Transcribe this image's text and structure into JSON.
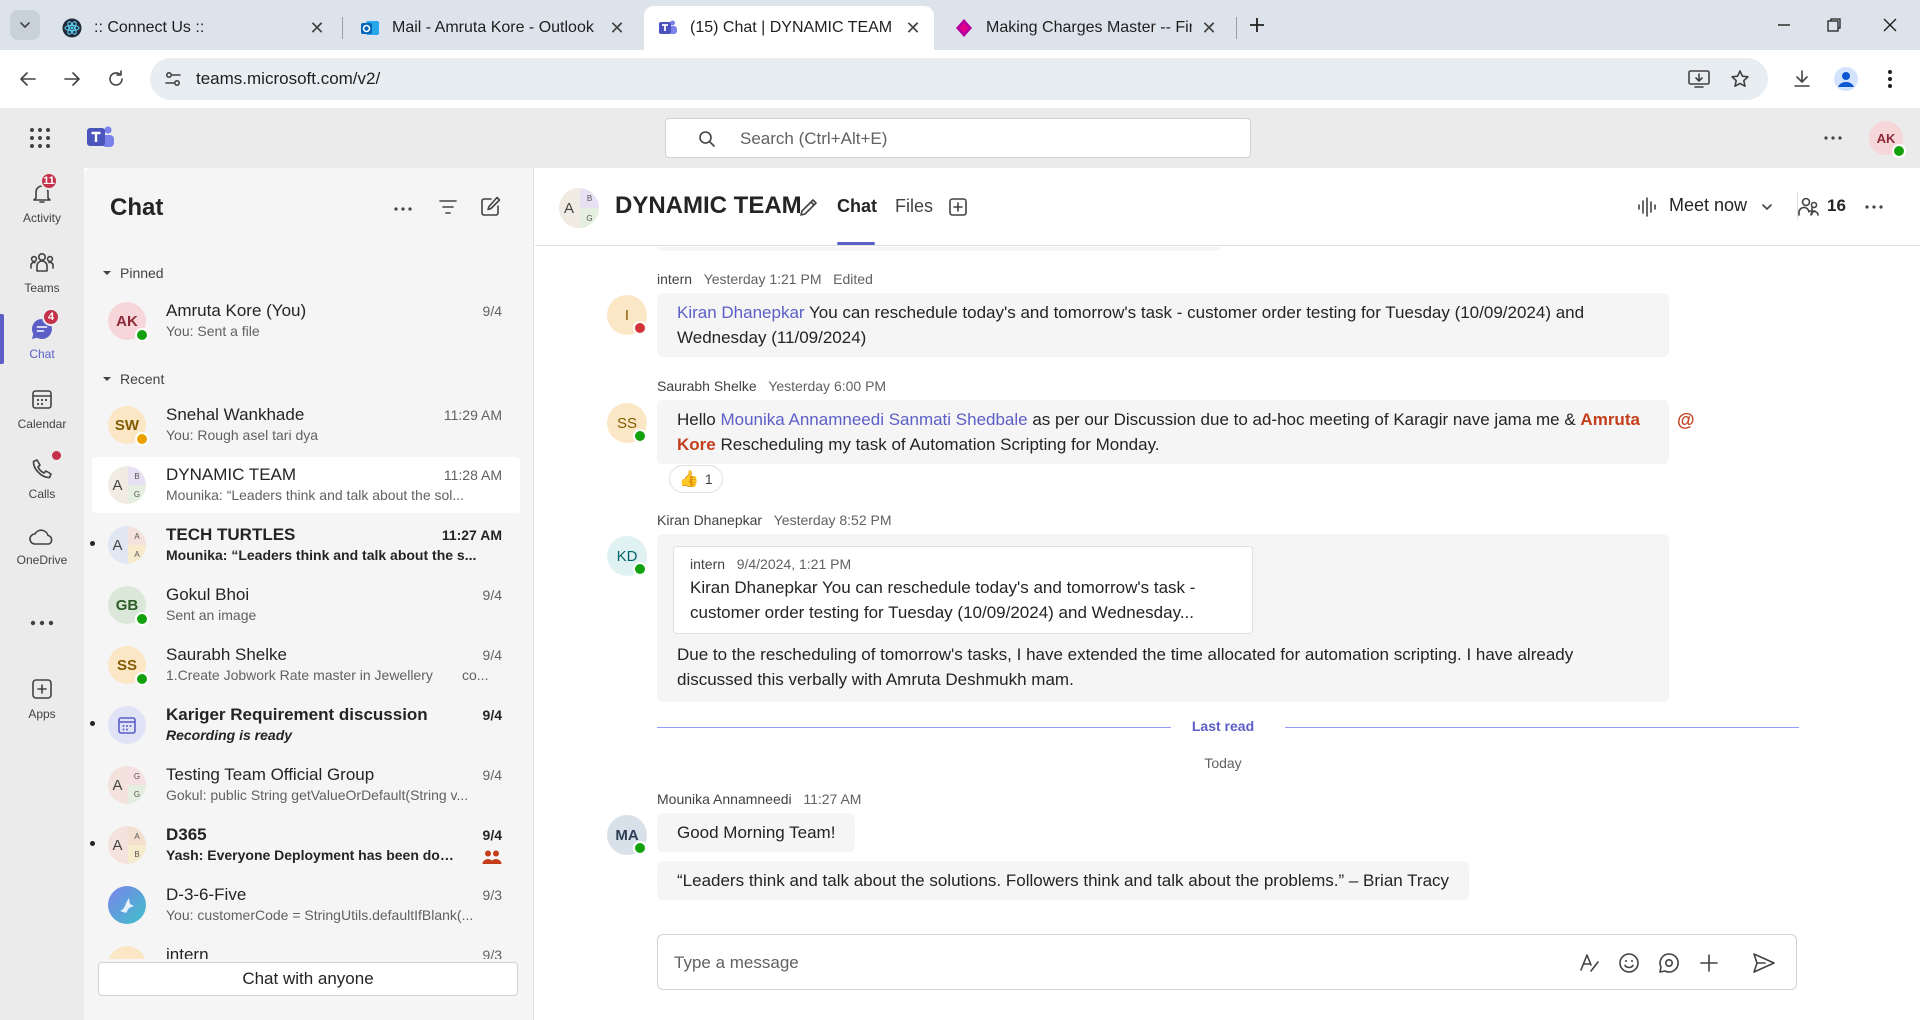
{
  "browser": {
    "tabs": [
      {
        "title": ":: Connect Us ::",
        "active": false
      },
      {
        "title": "Mail - Amruta Kore - Outlook",
        "active": false
      },
      {
        "title": "(15) Chat | DYNAMIC TEAM | Mi",
        "active": true
      },
      {
        "title": "Making Charges Master -- Finar",
        "active": false
      }
    ],
    "url": "teams.microsoft.com/v2/"
  },
  "header": {
    "search_placeholder": "Search (Ctrl+Alt+E)",
    "user_initials": "AK"
  },
  "rail": {
    "items": [
      {
        "label": "Activity",
        "icon": "bell-icon",
        "badge": "11"
      },
      {
        "label": "Teams",
        "icon": "teams-people-icon",
        "badge": ""
      },
      {
        "label": "Chat",
        "icon": "chat-bubble-icon",
        "badge": "4"
      },
      {
        "label": "Calendar",
        "icon": "calendar-icon",
        "badge": ""
      },
      {
        "label": "Calls",
        "icon": "phone-icon",
        "badge": ""
      },
      {
        "label": "OneDrive",
        "icon": "cloud-icon",
        "badge": ""
      },
      {
        "label": "Apps",
        "icon": "apps-add-icon",
        "badge": ""
      }
    ]
  },
  "chat_list": {
    "title": "Chat",
    "pinned_label": "Pinned",
    "recent_label": "Recent",
    "pinned": [
      {
        "name": "Amruta Kore (You)",
        "preview": "You: Sent a file",
        "time": "9/4",
        "initials": "AK"
      }
    ],
    "recent": [
      {
        "name": "Snehal Wankhade",
        "preview": "You: Rough asel tari dya",
        "time": "11:29 AM",
        "initials": "SW"
      },
      {
        "name": "DYNAMIC TEAM",
        "preview": "Mounika: “Leaders think and talk about the sol...",
        "time": "11:28 AM",
        "initials": "A",
        "g1": "B",
        "g2": "G"
      },
      {
        "name": "TECH TURTLES",
        "preview": "Mounika: “Leaders think and talk about the s...",
        "time": "11:27 AM",
        "initials": "A",
        "g1": "A",
        "g2": "A"
      },
      {
        "name": "Gokul Bhoi",
        "preview": "Sent an image",
        "time": "9/4",
        "initials": "GB"
      },
      {
        "name": "Saurabh Shelke",
        "preview": "1.Create Jobwork Rate master in Jewellery",
        "preview_tail": "co...",
        "time": "9/4",
        "initials": "SS"
      },
      {
        "name": "Kariger Requirement discussion",
        "preview": "Recording is ready",
        "time": "9/4",
        "initials": ""
      },
      {
        "name": "Testing Team Official Group",
        "preview": "Gokul: public String getValueOrDefault(String v...",
        "time": "9/4",
        "initials": "A",
        "g1": "G",
        "g2": "G"
      },
      {
        "name": "D365",
        "preview": "Yash: Everyone Deployment has been done",
        "time": "9/4",
        "initials": "A",
        "g1": "A",
        "g2": "B"
      },
      {
        "name": "D-3-6-Five",
        "preview": "You: customerCode = StringUtils.defaultIfBlank(...",
        "time": "9/3",
        "initials": ""
      },
      {
        "name": "intern",
        "preview": "",
        "time": "9/3",
        "initials": ""
      }
    ],
    "chat_with_anyone": "Chat with anyone"
  },
  "conversation": {
    "title": "DYNAMIC TEAM",
    "avatar": {
      "initials": "A",
      "g1": "B",
      "g2": "G"
    },
    "tabs": [
      {
        "label": "Chat",
        "active": true
      },
      {
        "label": "Files",
        "active": false
      }
    ],
    "meet_now": "Meet now",
    "participants": "16",
    "messages": [
      {
        "author": "intern",
        "time": "Yesterday 1:21 PM",
        "edited": "Edited",
        "initials": "I",
        "mention": "Kiran Dhanepkar",
        "text": " You can reschedule today's and tomorrow's task - customer order testing for Tuesday (10/09/2024) and Wednesday (11/09/2024)"
      },
      {
        "author": "Saurabh Shelke",
        "time": "Yesterday 6:00 PM",
        "initials": "SS",
        "prefix": "Hello ",
        "mention": "Mounika Annamneedi Sanmati Shedbale",
        "middle": " as per our Discussion due to ad-hoc meeting of Karagir nave jama me & ",
        "mention_me": "Amruta Kore",
        "suffix": " Rescheduling my task of Automation Scripting for Monday.",
        "reaction": {
          "emoji": "👍",
          "count": "1"
        }
      },
      {
        "author": "Kiran Dhanepkar",
        "time": "Yesterday 8:52 PM",
        "initials": "KD",
        "quote": {
          "author": "intern",
          "time": "9/4/2024, 1:21 PM",
          "text": "Kiran Dhanepkar You can reschedule today's and tomorrow's task - customer order testing for Tuesday (10/09/2024) and Wednesday..."
        },
        "text": "Due to the rescheduling of tomorrow's tasks, I have extended the time allocated for automation scripting. I have already discussed this verbally with Amruta Deshmukh mam."
      },
      {
        "author": "Mounika Annamneedi",
        "time": "11:27 AM",
        "initials": "MA",
        "text": "Good Morning Team!",
        "text2": "“Leaders think and talk about the solutions. Followers think and talk about the problems.” – Brian Tracy"
      }
    ],
    "last_read": "Last read",
    "today": "Today",
    "compose_placeholder": "Type a message"
  },
  "colors": {
    "accent": "#5b5fc7",
    "badge": "#c4314b",
    "presence_available": "#13a10e",
    "presence_busy": "#d13438",
    "presence_away": "#e9a100"
  }
}
